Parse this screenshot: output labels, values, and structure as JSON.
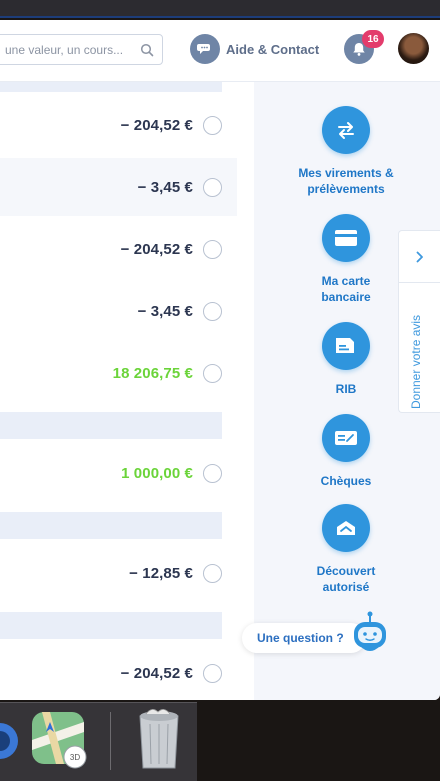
{
  "header": {
    "search_placeholder": "une valeur, un cours...",
    "help_label": "Aide & Contact",
    "notifications_count": "16"
  },
  "transactions": [
    {
      "amount": "− 204,52 €",
      "positive": false
    },
    {
      "amount": "− 3,45 €",
      "positive": false
    },
    {
      "amount": "− 204,52 €",
      "positive": false
    },
    {
      "amount": "− 3,45 €",
      "positive": false
    },
    {
      "amount": "18 206,75 €",
      "positive": true
    },
    {
      "amount": "1 000,00 €",
      "positive": true
    },
    {
      "amount": "− 12,85 €",
      "positive": false
    },
    {
      "amount": "− 204,52 €",
      "positive": false
    }
  ],
  "sidebar": {
    "actions": [
      {
        "line1": "Mes virements &",
        "line2": "prélèvements",
        "icon": "transfer-icon"
      },
      {
        "line1": "Ma carte",
        "line2": "bancaire",
        "icon": "card-icon"
      },
      {
        "line1": "RIB",
        "line2": "",
        "icon": "rib-icon"
      },
      {
        "line1": "Chèques",
        "line2": "",
        "icon": "cheque-icon"
      },
      {
        "line1": "Découvert",
        "line2": "autorisé",
        "icon": "overdraft-icon"
      }
    ],
    "feedback_label": "Donner votre avis",
    "chat_label": "Une question ?"
  },
  "colors": {
    "accent": "#2f95dd",
    "positive": "#6bd43a",
    "badge": "#e33c6c"
  }
}
